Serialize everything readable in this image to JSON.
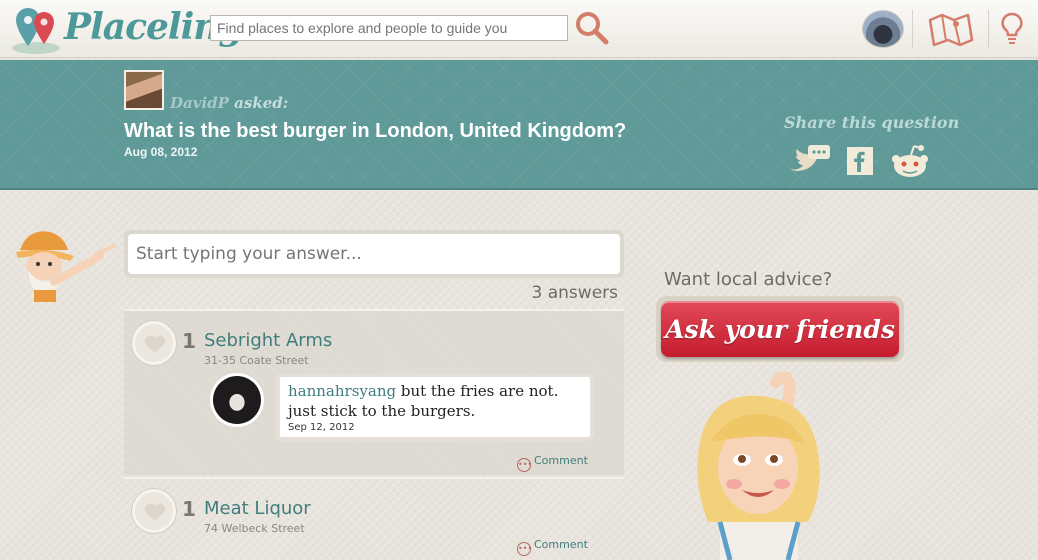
{
  "header": {
    "logo_text": "Placeling",
    "search_placeholder": "Find places to explore and people to guide you"
  },
  "question": {
    "asker_name": "DavidP",
    "asked_label": "asked:",
    "title": "What is the best burger in London, United Kingdom?",
    "date": "Aug 08, 2012"
  },
  "share": {
    "label": "Share this question",
    "icons": [
      "twitter-icon",
      "facebook-icon",
      "reddit-icon"
    ]
  },
  "answer_box": {
    "placeholder": "Start typing your answer..."
  },
  "answers_count": "3 answers",
  "answers": [
    {
      "likes": "1",
      "place": "Sebright Arms",
      "address": "31-35 Coate Street",
      "comment": {
        "user": "hannahrsyang",
        "text": " but the fries are not. just stick to the burgers.",
        "date": "Sep 12, 2012"
      },
      "comment_label": "Comment"
    },
    {
      "likes": "1",
      "place": "Meat Liquor",
      "address": "74 Welbeck Street",
      "comment_label": "Comment"
    }
  ],
  "sidebar": {
    "want_advice": "Want local advice?",
    "ask_button": "Ask your friends"
  },
  "colors": {
    "teal_band": "#5f9a99",
    "link_teal": "#417d7d",
    "ask_red": "#d2303f",
    "page_bg": "#e9e5de"
  }
}
